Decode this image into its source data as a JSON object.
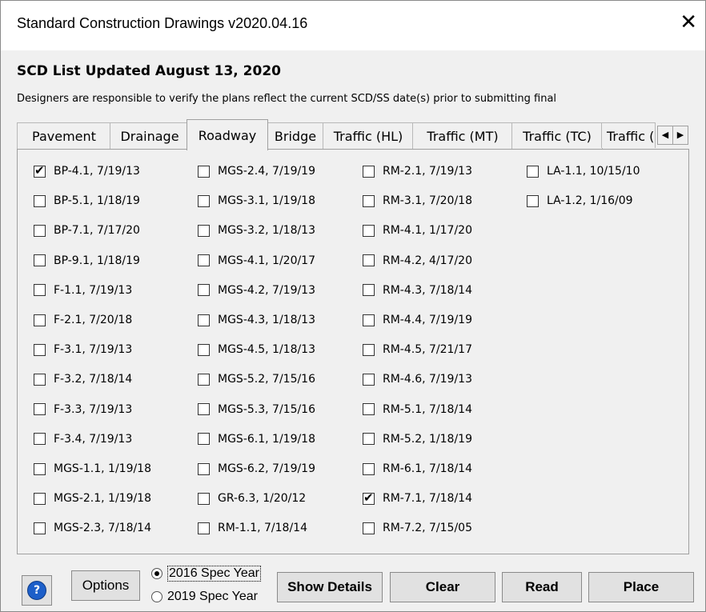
{
  "window": {
    "title": "Standard Construction Drawings v2020.04.16",
    "close_glyph": "✕"
  },
  "updated_text": "SCD List Updated August 13, 2020",
  "notice_text": "Designers are responsible to verify the plans reflect the current SCD/SS date(s) prior to submitting final",
  "tabs": [
    {
      "label": "Pavement",
      "active": false
    },
    {
      "label": "Drainage",
      "active": false
    },
    {
      "label": "Roadway",
      "active": true
    },
    {
      "label": "Bridge",
      "active": false
    },
    {
      "label": "Traffic (HL)",
      "active": false
    },
    {
      "label": "Traffic (MT)",
      "active": false
    },
    {
      "label": "Traffic (TC)",
      "active": false
    },
    {
      "label": "Traffic (",
      "active": false
    }
  ],
  "tab_scroll": {
    "left": "◀",
    "right": "▶"
  },
  "columns": [
    [
      {
        "label": "BP-4.1, 7/19/13",
        "checked": true
      },
      {
        "label": "BP-5.1, 1/18/19",
        "checked": false
      },
      {
        "label": "BP-7.1, 7/17/20",
        "checked": false
      },
      {
        "label": "BP-9.1, 1/18/19",
        "checked": false
      },
      {
        "label": "F-1.1, 7/19/13",
        "checked": false
      },
      {
        "label": "F-2.1, 7/20/18",
        "checked": false
      },
      {
        "label": "F-3.1, 7/19/13",
        "checked": false
      },
      {
        "label": "F-3.2, 7/18/14",
        "checked": false
      },
      {
        "label": "F-3.3, 7/19/13",
        "checked": false
      },
      {
        "label": "F-3.4, 7/19/13",
        "checked": false
      },
      {
        "label": "MGS-1.1, 1/19/18",
        "checked": false
      },
      {
        "label": "MGS-2.1, 1/19/18",
        "checked": false
      },
      {
        "label": "MGS-2.3, 7/18/14",
        "checked": false
      }
    ],
    [
      {
        "label": "MGS-2.4, 7/19/19",
        "checked": false
      },
      {
        "label": "MGS-3.1, 1/19/18",
        "checked": false
      },
      {
        "label": "MGS-3.2, 1/18/13",
        "checked": false
      },
      {
        "label": "MGS-4.1, 1/20/17",
        "checked": false
      },
      {
        "label": "MGS-4.2, 7/19/13",
        "checked": false
      },
      {
        "label": "MGS-4.3, 1/18/13",
        "checked": false
      },
      {
        "label": "MGS-4.5, 1/18/13",
        "checked": false
      },
      {
        "label": "MGS-5.2, 7/15/16",
        "checked": false
      },
      {
        "label": "MGS-5.3, 7/15/16",
        "checked": false
      },
      {
        "label": "MGS-6.1, 1/19/18",
        "checked": false
      },
      {
        "label": "MGS-6.2, 7/19/19",
        "checked": false
      },
      {
        "label": "GR-6.3, 1/20/12",
        "checked": false
      },
      {
        "label": "RM-1.1, 7/18/14",
        "checked": false
      }
    ],
    [
      {
        "label": "RM-2.1, 7/19/13",
        "checked": false
      },
      {
        "label": "RM-3.1, 7/20/18",
        "checked": false
      },
      {
        "label": "RM-4.1, 1/17/20",
        "checked": false
      },
      {
        "label": "RM-4.2, 4/17/20",
        "checked": false
      },
      {
        "label": "RM-4.3, 7/18/14",
        "checked": false
      },
      {
        "label": "RM-4.4, 7/19/19",
        "checked": false
      },
      {
        "label": "RM-4.5, 7/21/17",
        "checked": false
      },
      {
        "label": "RM-4.6, 7/19/13",
        "checked": false
      },
      {
        "label": "RM-5.1, 7/18/14",
        "checked": false
      },
      {
        "label": "RM-5.2, 1/18/19",
        "checked": false
      },
      {
        "label": "RM-6.1, 7/18/14",
        "checked": false
      },
      {
        "label": "RM-7.1, 7/18/14",
        "checked": true
      },
      {
        "label": "RM-7.2, 7/15/05",
        "checked": false
      }
    ],
    [
      {
        "label": "LA-1.1, 10/15/10",
        "checked": false
      },
      {
        "label": "LA-1.2, 1/16/09",
        "checked": false
      }
    ]
  ],
  "footer": {
    "options_label": "Options",
    "spec_2016": "2016 Spec Year",
    "spec_2019": "2019 Spec Year",
    "selected_spec": "2016",
    "show_details_label": "Show Details",
    "clear_label": "Clear",
    "read_label": "Read",
    "place_label": "Place",
    "help_glyph": "?"
  },
  "colors": {
    "accent": "#1d5fc9",
    "panel_bg": "#f0f0f0",
    "title_bg": "#ffffff"
  }
}
